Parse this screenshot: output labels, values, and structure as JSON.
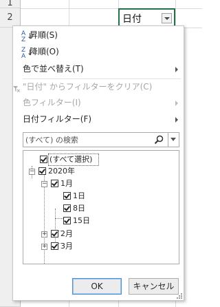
{
  "sheet": {
    "row_headers": [
      "1",
      "2"
    ],
    "cell_value": "日付"
  },
  "menu": {
    "sort_asc": "昇順(S)",
    "sort_desc": "降順(O)",
    "sort_by_color": "色で並べ替え(T)",
    "clear_filter": "\"日付\" からフィルターをクリア(C)",
    "color_filter": "色フィルター(I)",
    "date_filter": "日付フィルター(F)"
  },
  "search": {
    "placeholder": "(すべて) の検索"
  },
  "tree": {
    "select_all": "(すべて選択)",
    "year": "2020年",
    "month1": "1月",
    "days": [
      "1日",
      "8日",
      "15日"
    ],
    "month2": "2月",
    "month3": "3月"
  },
  "buttons": {
    "ok": "OK",
    "cancel": "キャンセル"
  },
  "colors": {
    "selection_border": "#217346",
    "sort_icon": "#2b579a",
    "ok_focus": "#4f8fd6"
  }
}
